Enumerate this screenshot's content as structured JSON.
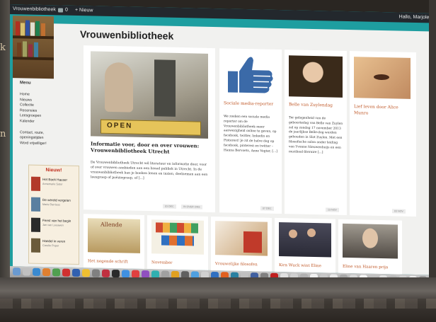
{
  "left_margin_text": [
    "k",
    "n"
  ],
  "admin_bar": {
    "site_name": "Vrouwenbibliotheek",
    "comments_count": "0",
    "new_label": "+ Nieuw",
    "greeting": "Hallo, Marjolei"
  },
  "site": {
    "title": "Vrouwenbibliotheek"
  },
  "menu": {
    "title": "Menu",
    "items": [
      "Home",
      "Nieuws",
      "Collectie",
      "Recensies",
      "Leesgroepen",
      "Kalender"
    ],
    "items2": [
      "Contact, route,",
      "openingstijden",
      "Word vrijwilliger!"
    ]
  },
  "nieuw": {
    "title": "Nieuw!",
    "books": [
      {
        "title": "Het Boek Hauser",
        "author": "Annemarie Sutor",
        "color": "#b23a2a"
      },
      {
        "title": "De wereld vergeten",
        "author": "Marie Darrieus",
        "color": "#5a7fa0"
      },
      {
        "title": "Feest van het begin",
        "author": "Jan van Leeuwen",
        "color": "#2a2a2a"
      },
      {
        "title": "Handel in veren",
        "author": "Carolie Poper",
        "color": "#6a5a3a"
      }
    ]
  },
  "featured": {
    "sign_text": "OPEN",
    "title": "Informatie voor, door en over vrouwen: Vrouwenbibliotheek Utrecht",
    "text": "De Vrouwenbibliotheek Utrecht wil literatuur en informatie door, voor of over vrouwen aanbieden aan een breed publiek in Utrecht. In de vrouwenbibliotheek kan je boeken lenen en inzien, deelnemen aan een leesgroep of poëziegroep, of [...]",
    "date": "03 DEC",
    "meta": "IN OVER ONS"
  },
  "cards": [
    {
      "title": "Sociale media-reporter",
      "text": "We zoeken een sociale media reporter om de Vrouwenbibliotheek meer aanwezigheid online te geven, op facebook, twitter, linkedin en Pinterest! Je zit de halve dag op facebook, pinterest en twitter – Hanna Bervoets, Anne Vegter, [...]",
      "date": "07 DEC"
    },
    {
      "title": "Belle van Zuylendag",
      "text": "Ter gelegenheid van de geboortedag van Belle van Zuylen zal op zondag 17 november 2013 de jaarlijkse Belle-dag worden gehouden in Slot Zuylen. Met een filosofische salon onder leiding van Yvonne Nieuwenhuijs en een muzikaal-literaire [...]",
      "date": "13 NOV"
    },
    {
      "title": "Lief leven door Alice Munro",
      "text": "",
      "date": "03 NOV"
    }
  ],
  "bottom_row": [
    {
      "caption": "Het negende schrift",
      "image_text": "Allende"
    },
    {
      "caption": "November",
      "image_text": "BEZIEK BIJ HET"
    },
    {
      "caption": "Vrouwelijke filosofen",
      "image_text": ""
    },
    {
      "caption": "Kira Wuck wint Eline",
      "image_text": ""
    },
    {
      "caption": "Eline van Haaren prija",
      "image_text": ""
    }
  ],
  "colors": {
    "teal_background": "#1e9ea0",
    "admin_bar": "#23282d",
    "card_title": "#c05a2a",
    "nieuw_title": "#c03020"
  },
  "icons": {
    "like": "thumbs-up-icon",
    "dock": "macos-dock-icons"
  }
}
